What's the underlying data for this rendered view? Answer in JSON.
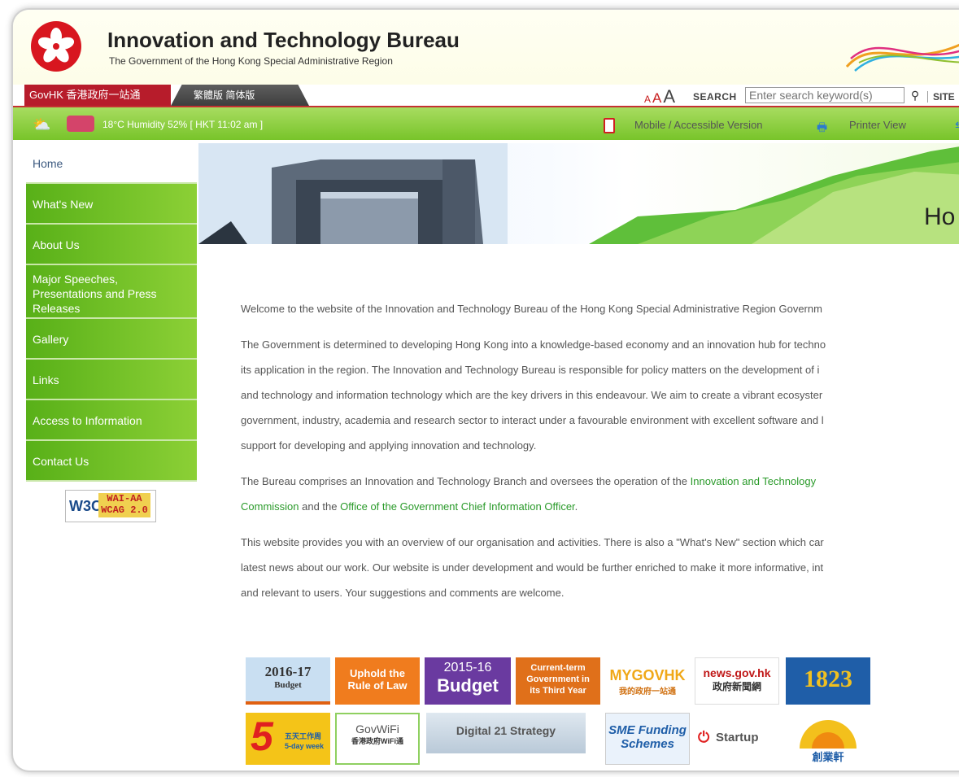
{
  "header": {
    "title": "Innovation and Technology Bureau",
    "subtitle": "The Government of the Hong Kong Special Administrative Region"
  },
  "topnav": {
    "govhk": "GovHK 香港政府一站通",
    "lang": "繁體版  简体版",
    "font_small": "A",
    "font_medium": "A",
    "font_large": "A",
    "search_label": "SEARCH",
    "search_placeholder": "Enter search keyword(s)",
    "site_label": "SITE"
  },
  "infobar": {
    "weather": "18°C Humidity 52% [ HKT 11:02 am ]",
    "mobile": "Mobile / Accessible Version",
    "printer": "Printer View"
  },
  "nav": {
    "items": [
      {
        "label": "Home"
      },
      {
        "label": "What's New"
      },
      {
        "label": "About Us"
      },
      {
        "label": "Major Speeches, Presentations and Press Releases"
      },
      {
        "label": "Gallery"
      },
      {
        "label": "Links"
      },
      {
        "label": "Access to Information"
      },
      {
        "label": "Contact Us"
      }
    ]
  },
  "badge": {
    "w3c": "W3C",
    "wai": "WAI-AA",
    "wcag": "WCAG 2.0"
  },
  "banner": {
    "text": "Ho"
  },
  "content": {
    "p1": "Welcome to the website of the Innovation and Technology Bureau of the Hong Kong Special Administrative Region Governm",
    "p2_l1": "The Government is determined to developing Hong Kong into a knowledge-based economy and an innovation hub for techno",
    "p2_l2": "its application in the region. The Innovation and Technology Bureau is responsible for policy matters on the development of i",
    "p2_l3": "and technology and information technology which are the key drivers in this endeavour. We aim to create a vibrant ecosyster",
    "p2_l4": "government, industry, academia and research sector to interact under a favourable environment with excellent software and l",
    "p2_l5": "support for developing and applying innovation and technology.",
    "p3_l1_pre": "The Bureau comprises an Innovation and Technology Branch and oversees the operation of the ",
    "p3_l1_link": "Innovation and Technology",
    "p3_l2_link1": "Commission",
    "p3_l2_mid": " and the ",
    "p3_l2_link2": "Office of the Government Chief Information Officer",
    "p3_l2_end": ".",
    "p4_l1": "This website provides you with an overview of our organisation and activities. There is also a \"What's New\" section which car",
    "p4_l2": "latest news about our work. Our website is under development and would be further enriched to make it more informative, int",
    "p4_l3": "and relevant to users. Your suggestions and comments are welcome."
  },
  "logos": {
    "budget2016_a": "2016-17",
    "budget2016_b": "Budget",
    "rule_a": "Uphold the",
    "rule_b": "Rule of Law",
    "budget2015_a": "2015-16",
    "budget2015_b": "Budget",
    "term_a": "Current-term",
    "term_b": "Government in",
    "term_c": "its Third Year",
    "mygov_a": "MYGOVHK",
    "mygov_b": "我的政府一站通",
    "news_a": "news.gov.hk",
    "news_b": "政府新聞網",
    "n1823": "1823",
    "fiveday_a": "5",
    "fiveday_b": "五天工作周",
    "fiveday_c": "5-day week",
    "wifi_a": "GovWiFi",
    "wifi_b": "香港政府WiFi通",
    "d21": "Digital 21 Strategy",
    "sme_a": "SME Funding",
    "sme_b": "Schemes",
    "startup": "Startup",
    "chuang": "創業軒"
  },
  "colors": {
    "nav_green": "#6cbd24",
    "govhk_red": "#b71c2b",
    "link_green": "#2a9a2a"
  }
}
